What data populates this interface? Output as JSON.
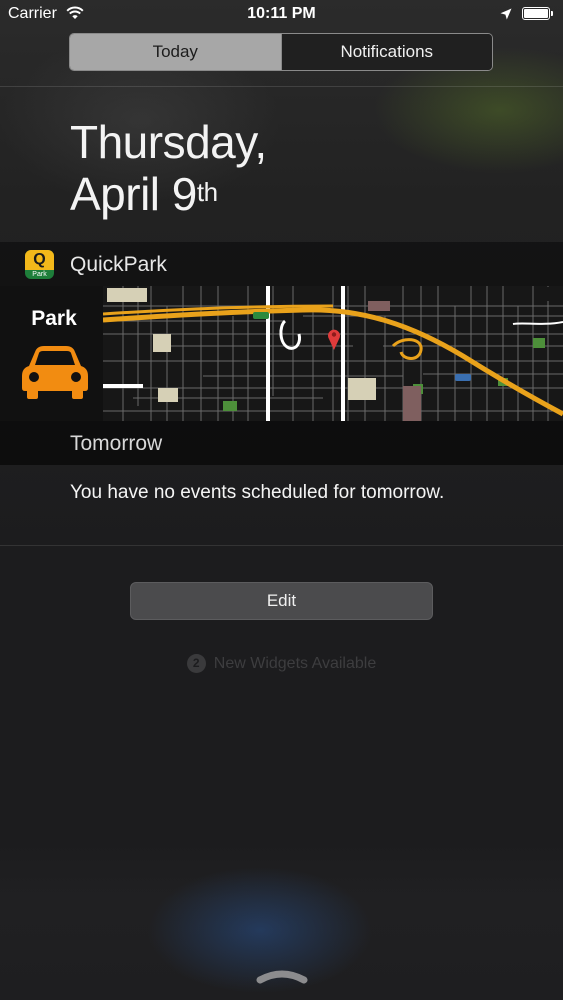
{
  "status_bar": {
    "carrier": "Carrier",
    "time": "10:11 PM",
    "icons": [
      "wifi-icon",
      "location-arrow-icon",
      "battery-icon"
    ]
  },
  "segment": {
    "tabs": [
      {
        "label": "Today",
        "selected": true
      },
      {
        "label": "Notifications",
        "selected": false
      }
    ]
  },
  "date": {
    "line1": "Thursday,",
    "line2_main": "April 9",
    "line2_suffix": "th"
  },
  "widget": {
    "app_name": "QuickPark",
    "icon_letter": "Q",
    "icon_caption": "Park",
    "park_label": "Park",
    "map_icon": "map-pin-icon",
    "accent_color": "#f28c11"
  },
  "tomorrow": {
    "header": "Tomorrow",
    "message": "You have no events scheduled for tomorrow."
  },
  "edit_button": {
    "label": "Edit"
  },
  "new_widgets": {
    "count": "2",
    "label": "New Widgets Available"
  },
  "colors": {
    "segment_selected": "#a7a7a7",
    "map_road": "#e9a21b",
    "pin": "#e03b3b"
  }
}
